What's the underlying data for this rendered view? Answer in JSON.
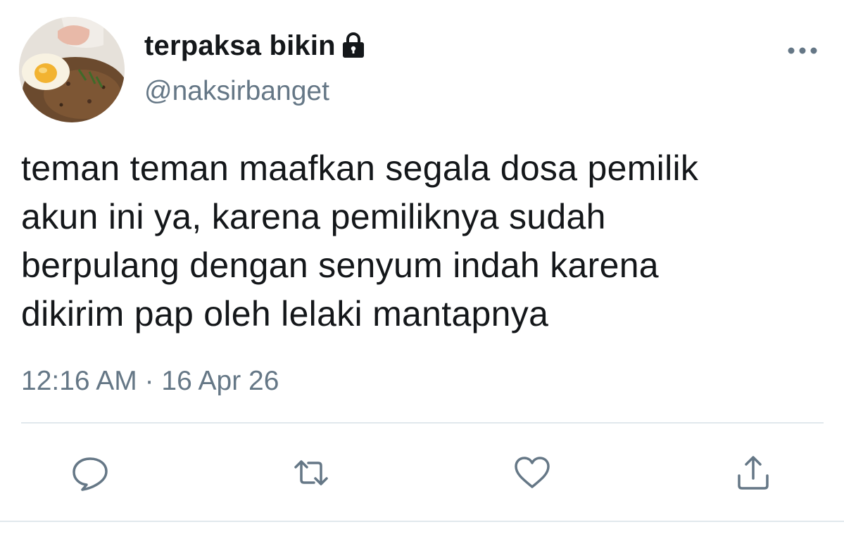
{
  "user": {
    "display_name": "terpaksa bikin",
    "handle": "@naksirbanget",
    "protected_icon": "lock-icon",
    "avatar": "profile-photo-fried-rice-with-egg"
  },
  "header": {
    "more_icon": "more-horizontal-icon"
  },
  "tweet": {
    "text_lines": [
      "teman teman maafkan segala dosa pemilik",
      "akun ini ya, karena pemiliknya sudah",
      "berpulang dengan senyum indah karena",
      "dikirim pap oleh lelaki mantapnya"
    ],
    "timestamp": "12:16 AM · 16 Apr 26"
  },
  "actions": [
    {
      "icon": "reply-icon"
    },
    {
      "icon": "retweet-icon"
    },
    {
      "icon": "like-icon"
    },
    {
      "icon": "share-icon"
    }
  ],
  "colors": {
    "primary_text": "#14171a",
    "secondary_text": "#657786",
    "divider": "#e1e8ed",
    "icon": "#657786"
  }
}
